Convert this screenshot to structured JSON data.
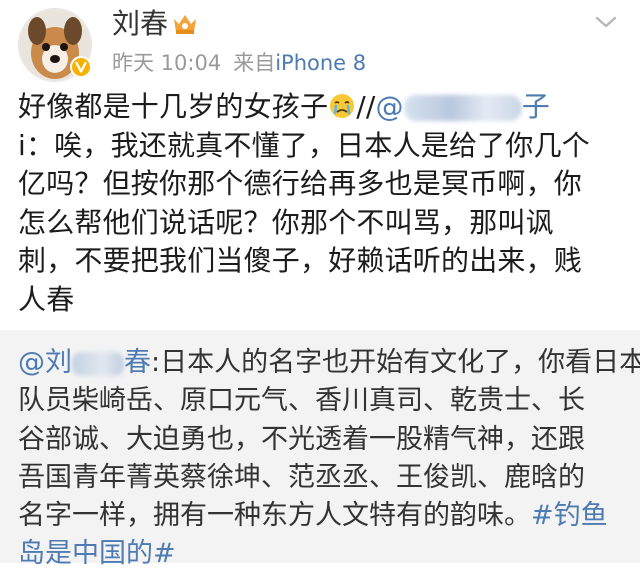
{
  "post": {
    "author": {
      "name": "刘春",
      "avatar_icon": "dog-avatar",
      "verified_icon": "verified-v-icon",
      "level_icon": "crown-icon"
    },
    "time": "昨天 10:04",
    "source_label": "来自",
    "source_device": "iPhone 8",
    "menu_icon": "chevron-down-icon",
    "body_lines": {
      "l1_text": "好像都是十几岁的女孩子",
      "l1_slashes": "//",
      "l1_at": "@",
      "l1_tail": "子",
      "l2": "i：唉，我还就真不懂了，日本人是给了你几个",
      "l3": "亿吗？但按你那个德行给再多也是冥币啊，你",
      "l4": "怎么帮他们说话呢？你那个不叫骂，那叫讽",
      "l5": "刺，不要把我们当傻子，好赖话听的出来，贱",
      "l6": "人春"
    },
    "emoji_icon": "crying-face-emoji"
  },
  "repost": {
    "at_prefix": "@刘",
    "at_suffix": "春",
    "l1_rest": ":日本人的名字也开始有文化了，你看日本",
    "l2": "队员柴崎岳、原口元气、香川真司、乾贵士、长",
    "l3": "谷部诚、大迫勇也，不光透着一股精气神，还跟",
    "l4": "吾国青年菁英蔡徐坤、范丞丞、王俊凯、鹿晗的",
    "l5_text": "名字一样，拥有一种东方人文特有的韵味。",
    "l5_topic": "#钓鱼",
    "l6_topic": "岛是中国的#"
  },
  "colors": {
    "link": "#4d7bb2",
    "meta_gray": "#9a9a9a",
    "repost_bg": "#f3f3f3",
    "badge_orange": "#f7b100"
  }
}
